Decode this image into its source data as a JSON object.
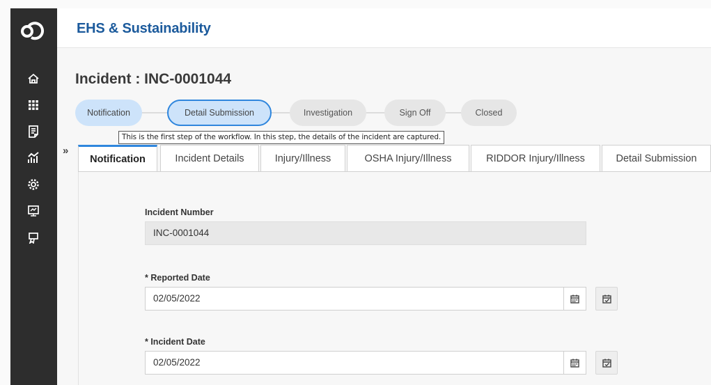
{
  "app": {
    "title": "EHS & Sustainability"
  },
  "sidebar": {
    "logo": "logo-icon",
    "items": [
      {
        "icon": "home-icon"
      },
      {
        "icon": "apps-grid-icon"
      },
      {
        "icon": "document-icon"
      },
      {
        "icon": "analytics-icon"
      },
      {
        "icon": "settings-icon"
      },
      {
        "icon": "monitor-icon"
      },
      {
        "icon": "certificate-icon"
      }
    ]
  },
  "page": {
    "title": "Incident : INC-0001044"
  },
  "workflow": {
    "steps": [
      "Notification",
      "Detail Submission",
      "Investigation",
      "Sign Off",
      "Closed"
    ],
    "tooltip": "This is the first step of the workflow.  In this step, the details of the incident are captured."
  },
  "tabs": [
    "Notification",
    "Incident Details",
    "Injury/Illness",
    "OSHA Injury/Illness",
    "RIDDOR Injury/Illness",
    "Detail Submission"
  ],
  "form": {
    "incident_number": {
      "label": "Incident Number",
      "value": "INC-0001044"
    },
    "reported_date": {
      "label": "* Reported Date",
      "value": "02/05/2022"
    },
    "incident_date": {
      "label": "* Incident Date",
      "value": "02/05/2022"
    }
  },
  "colors": {
    "brand": "#1b5a9c",
    "accent": "#2f86dd",
    "sidebar": "#2d2d2d",
    "step_active": "#cde3fa"
  }
}
